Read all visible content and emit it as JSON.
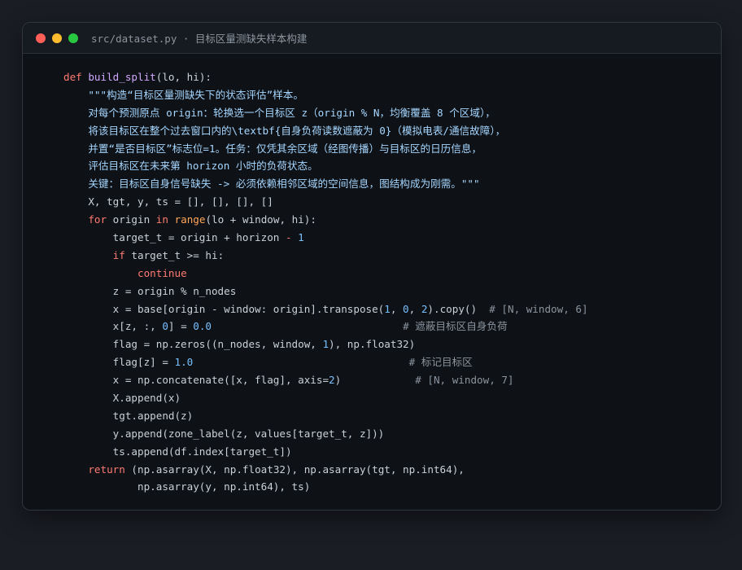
{
  "window": {
    "title": "src/dataset.py · 目标区量测缺失样本构建",
    "controls": {
      "close_color": "#ff5f57",
      "minimize_color": "#febc2e",
      "maximize_color": "#28c840"
    }
  },
  "theme": {
    "background": "#1a1d24",
    "editor_background": "#0e1116",
    "keyword": "#ff7b72",
    "function": "#d2a8ff",
    "builtin": "#ffa657",
    "number": "#79c0ff",
    "string": "#a5d6ff",
    "comment": "#8b949e",
    "text": "#c9d1d9"
  },
  "code_lines": [
    [
      [
        "kw",
        "def"
      ],
      [
        "t",
        " "
      ],
      [
        "fn",
        "build_split"
      ],
      [
        "t",
        "(lo, hi):"
      ]
    ],
    [
      [
        "str",
        "    \"\"\"构造“目标区量测缺失下的状态评估”样本。"
      ]
    ],
    [
      [
        "str",
        "    对每个预测原点 origin：轮换选一个目标区 z（origin % N，均衡覆盖 8 个区域），"
      ]
    ],
    [
      [
        "str",
        "    将该目标区在整个过去窗口内的\\textbf{自身负荷读数遮蔽为 0}（模拟电表/通信故障），"
      ]
    ],
    [
      [
        "str",
        "    并置“是否目标区”标志位=1。任务：仅凭其余区域（经图传播）与目标区的日历信息，"
      ]
    ],
    [
      [
        "str",
        "    评估目标区在未来第 horizon 小时的负荷状态。"
      ]
    ],
    [
      [
        "str",
        "    关键：目标区自身信号缺失 -> 必须依赖相邻区域的空间信息，图结构成为刚需。\"\"\""
      ]
    ],
    [
      [
        "t",
        "    X, tgt, y, ts = [], [], [], []"
      ]
    ],
    [
      [
        "t",
        "    "
      ],
      [
        "kw",
        "for"
      ],
      [
        "t",
        " origin "
      ],
      [
        "kw",
        "in"
      ],
      [
        "t",
        " "
      ],
      [
        "bi",
        "range"
      ],
      [
        "t",
        "(lo + window, hi):"
      ]
    ],
    [
      [
        "t",
        "        target_t = origin + horizon "
      ],
      [
        "op",
        "-"
      ],
      [
        "t",
        " "
      ],
      [
        "num",
        "1"
      ]
    ],
    [
      [
        "t",
        "        "
      ],
      [
        "kw",
        "if"
      ],
      [
        "t",
        " target_t >= hi:"
      ]
    ],
    [
      [
        "t",
        "            "
      ],
      [
        "kw",
        "continue"
      ]
    ],
    [
      [
        "t",
        "        z = origin % n_nodes"
      ]
    ],
    [
      [
        "t",
        "        x = base[origin - window: origin].transpose("
      ],
      [
        "num",
        "1"
      ],
      [
        "t",
        ", "
      ],
      [
        "num",
        "0"
      ],
      [
        "t",
        ", "
      ],
      [
        "num",
        "2"
      ],
      [
        "t",
        ").copy()  "
      ],
      [
        "cm",
        "# [N, window, 6]"
      ]
    ],
    [
      [
        "t",
        "        x[z, :, "
      ],
      [
        "num",
        "0"
      ],
      [
        "t",
        "] = "
      ],
      [
        "num",
        "0.0"
      ],
      [
        "t",
        "                               "
      ],
      [
        "cm",
        "# 遮蔽目标区自身负荷"
      ]
    ],
    [
      [
        "t",
        "        flag = np.zeros((n_nodes, window, "
      ],
      [
        "num",
        "1"
      ],
      [
        "t",
        "), np.float32)"
      ]
    ],
    [
      [
        "t",
        "        flag[z] = "
      ],
      [
        "num",
        "1.0"
      ],
      [
        "t",
        "                                   "
      ],
      [
        "cm",
        "# 标记目标区"
      ]
    ],
    [
      [
        "t",
        "        x = np.concatenate([x, flag], axis="
      ],
      [
        "num",
        "2"
      ],
      [
        "t",
        ")            "
      ],
      [
        "cm",
        "# [N, window, 7]"
      ]
    ],
    [
      [
        "t",
        "        X.append(x)"
      ]
    ],
    [
      [
        "t",
        "        tgt.append(z)"
      ]
    ],
    [
      [
        "t",
        "        y.append(zone_label(z, values[target_t, z]))"
      ]
    ],
    [
      [
        "t",
        "        ts.append(df.index[target_t])"
      ]
    ],
    [
      [
        "t",
        "    "
      ],
      [
        "kw",
        "return"
      ],
      [
        "t",
        " (np.asarray(X, np.float32), np.asarray(tgt, np.int64),"
      ]
    ],
    [
      [
        "t",
        "            np.asarray(y, np.int64), ts)"
      ]
    ]
  ]
}
